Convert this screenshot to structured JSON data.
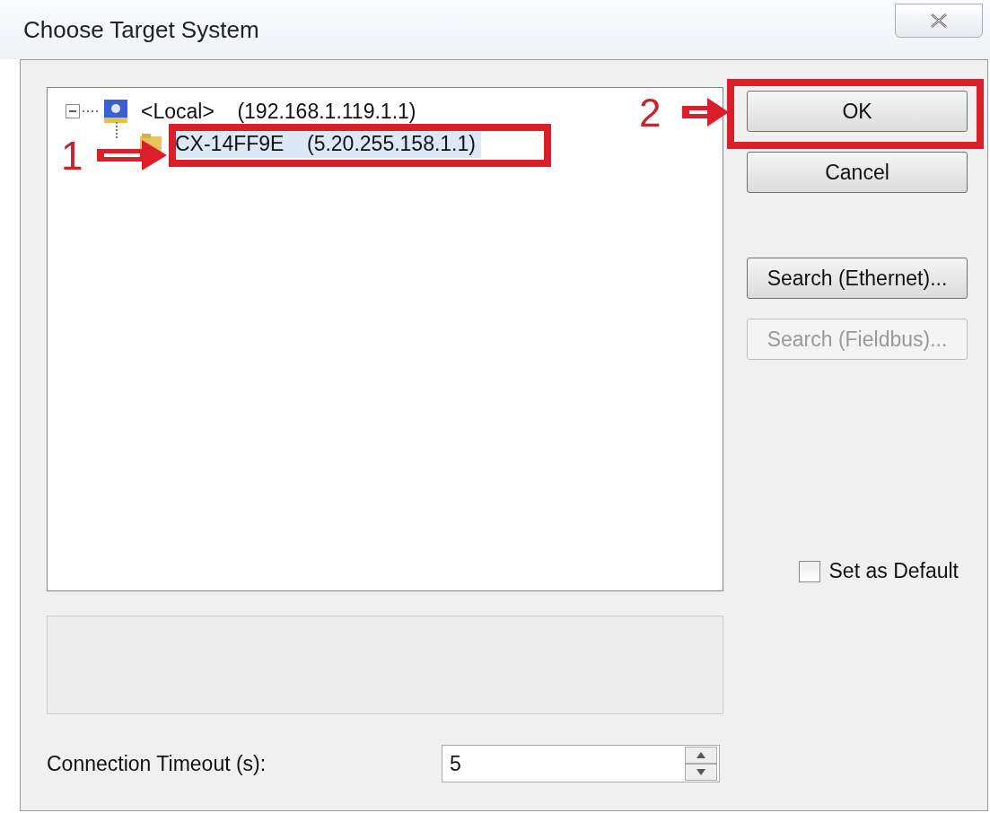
{
  "window": {
    "title": "Choose Target System"
  },
  "tree": [
    {
      "label": "<Local>",
      "address": "(192.168.1.119.1.1)",
      "expanded": true,
      "selected": false,
      "children": [
        {
          "label": "CX-14FF9E",
          "address": "(5.20.255.158.1.1)",
          "selected": true
        }
      ]
    }
  ],
  "buttons": [
    {
      "label": "OK",
      "disabled": false
    },
    {
      "label": "Cancel",
      "disabled": false
    },
    {
      "label": "Search (Ethernet)...",
      "disabled": false
    },
    {
      "label": "Search (Fieldbus)...",
      "disabled": true
    }
  ],
  "set_as_default": {
    "label": "Set as Default",
    "checked": false
  },
  "timeout": {
    "label": "Connection Timeout (s):",
    "value": "5"
  },
  "annotations": [
    {
      "number": "1"
    },
    {
      "number": "2"
    }
  ]
}
